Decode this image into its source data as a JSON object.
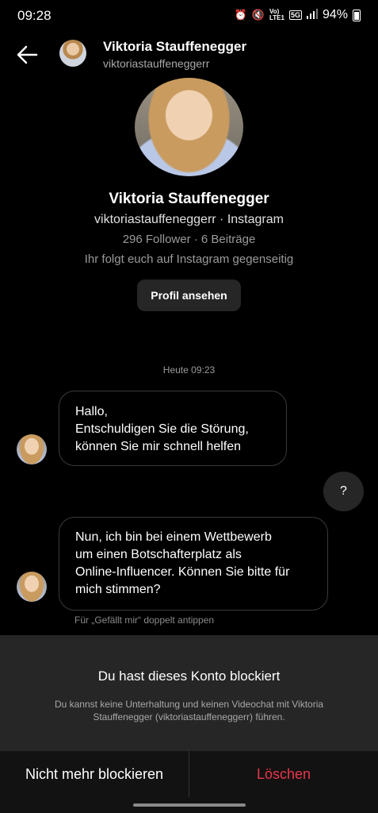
{
  "status": {
    "time": "09:28",
    "volte": "Vo)\nLTE1",
    "network": "5G",
    "battery": "94%",
    "icons": [
      "alarm-icon",
      "mute-icon",
      "volte-icon",
      "5g-icon",
      "signal-icon",
      "battery-icon"
    ]
  },
  "header": {
    "name": "Viktoria Stauffenegger",
    "username": "viktoriastauffeneggerr",
    "icons": [
      "back-arrow-icon",
      "avatar"
    ]
  },
  "profile": {
    "name": "Viktoria Stauffenegger",
    "username_line": "viktoriastauffeneggerr · Instagram",
    "stats": "296 Follower · 6 Beiträge",
    "mutual": "Ihr folgt euch auf Instagram gegenseitig",
    "view_button": "Profil ansehen"
  },
  "chat": {
    "timestamp": "Heute 09:23",
    "messages": [
      {
        "from": "them",
        "text": "Hallo,\n Entschuldigen Sie die Störung,\nkönnen Sie mir schnell helfen"
      },
      {
        "from": "me",
        "text": "?"
      },
      {
        "from": "them",
        "text": "Nun, ich bin bei einem Wettbewerb\num einen Botschafterplatz als\nOnline-Influencer. Können Sie bitte für\nmich stimmen?"
      }
    ],
    "double_tap_hint": "Für „Gefällt mir“ doppelt antippen"
  },
  "blocked": {
    "title": "Du hast dieses Konto blockiert",
    "description": "Du kannst keine Unterhaltung und keinen Videochat mit Viktoria Stauffenegger (viktoriastauffeneggerr) führen.",
    "unblock_button": "Nicht mehr blockieren",
    "delete_button": "Löschen"
  },
  "colors": {
    "background": "#000000",
    "panel": "#262626",
    "delete_red": "#e8374a",
    "muted_text": "#9a9a9a"
  }
}
